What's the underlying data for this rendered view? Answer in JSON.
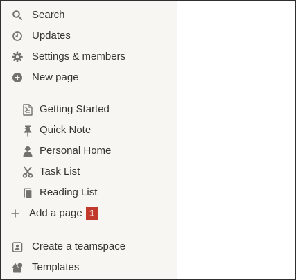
{
  "sidebar": {
    "top": {
      "search": "Search",
      "updates": "Updates",
      "settings": "Settings & members",
      "new_page": "New page"
    },
    "pages": [
      {
        "label": "Getting Started",
        "icon": "document-icon"
      },
      {
        "label": "Quick Note",
        "icon": "pin-icon"
      },
      {
        "label": "Personal Home",
        "icon": "person-icon"
      },
      {
        "label": "Task List",
        "icon": "scissors-icon"
      },
      {
        "label": "Reading List",
        "icon": "books-icon"
      }
    ],
    "add_page": "Add a page",
    "callout_badge": "1",
    "bottom": {
      "create_teamspace": "Create a teamspace",
      "templates": "Templates"
    }
  },
  "colors": {
    "sidebar_bg": "#f7f6f3",
    "text": "#37352f",
    "icon": "#73726e",
    "badge": "#c0392b"
  }
}
